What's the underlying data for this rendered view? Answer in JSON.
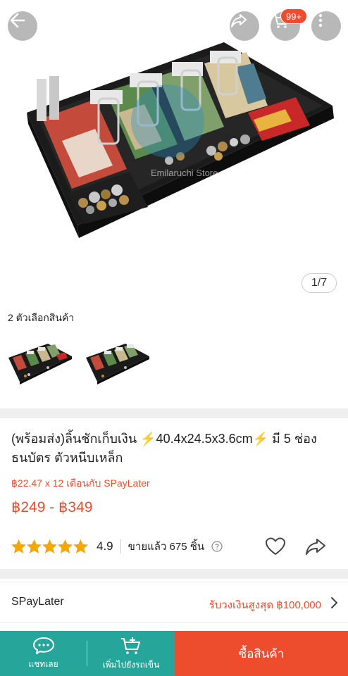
{
  "gallery": {
    "counter": "1/7",
    "watermark": "Emilaruchi Store"
  },
  "header": {
    "cart_badge": "99+"
  },
  "variants": {
    "label": "2 ตัวเลือกสินค้า"
  },
  "product": {
    "title": "(พร้อมส่ง)ลิ้นชักเก็บเงิน ⚡️40.4x24.5x3.6cm⚡️ มี 5 ช่องธนบัตร ตัวหนีบเหล็ก",
    "installment": "฿22.47 x 12 เดือนกับ SPayLater",
    "price": "฿249 - ฿349",
    "rating": "4.9",
    "rating_fraction": 0.98,
    "sold": "ขายแล้ว 675 ชิ้น"
  },
  "spaylater": {
    "label": "SPayLater",
    "value": "รับวงเงินสูงสุด ฿100,000"
  },
  "bottom_bar": {
    "chat_label": "แชทเลย",
    "add_cart_label": "เพิ่มไปยังรถเข็น",
    "buy_label": "ซื้อสินค้า"
  },
  "colors": {
    "accent": "#ee4d2d",
    "teal": "#26a69a",
    "star": "#f6a700"
  },
  "icons": [
    "back-arrow-icon",
    "share-icon",
    "cart-icon",
    "more-vertical-icon",
    "star-icon",
    "help-icon",
    "heart-icon",
    "chevron-right-icon",
    "chat-icon",
    "add-to-cart-icon"
  ]
}
